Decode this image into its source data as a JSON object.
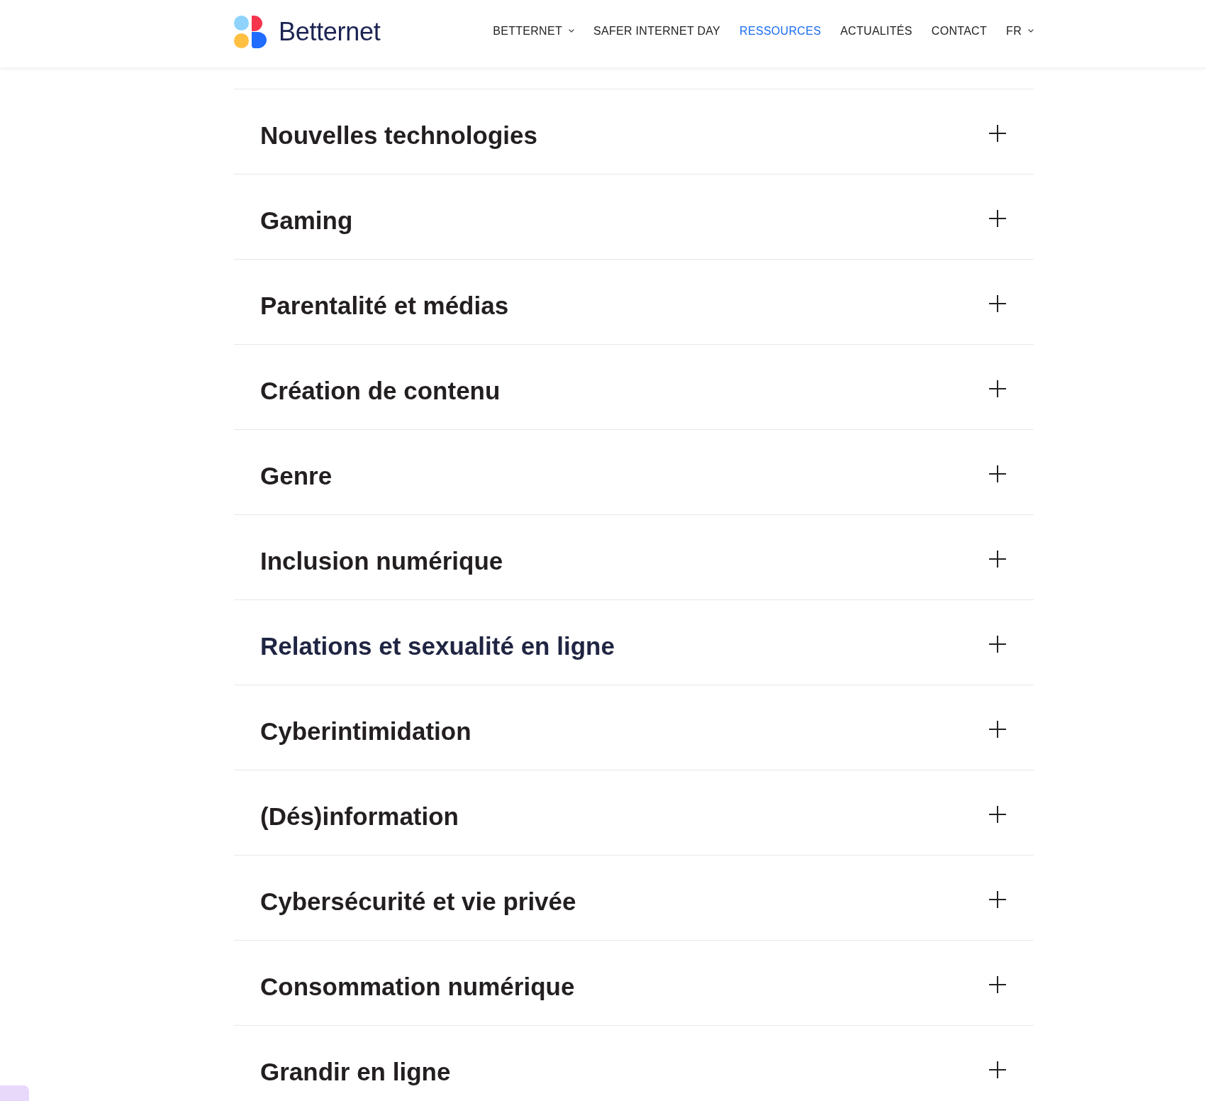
{
  "header": {
    "logo": {
      "text": "Betternet"
    },
    "nav": [
      {
        "label": "BETTERNET",
        "selected": false,
        "dropdown": true
      },
      {
        "label": "SAFER INTERNET DAY",
        "selected": false,
        "dropdown": false
      },
      {
        "label": "RESSOURCES",
        "selected": true,
        "dropdown": false
      },
      {
        "label": "ACTUALITÉS",
        "selected": false,
        "dropdown": false
      },
      {
        "label": "CONTACT",
        "selected": false,
        "dropdown": false
      },
      {
        "label": "FR",
        "selected": false,
        "dropdown": true
      }
    ]
  },
  "accordion": {
    "items": [
      {
        "title": "Nouvelles technologies",
        "expanded": false,
        "hovered": false
      },
      {
        "title": "Gaming",
        "expanded": false,
        "hovered": false
      },
      {
        "title": "Parentalité et médias",
        "expanded": false,
        "hovered": false
      },
      {
        "title": "Création de contenu",
        "expanded": false,
        "hovered": false
      },
      {
        "title": "Genre",
        "expanded": false,
        "hovered": false
      },
      {
        "title": "Inclusion numérique",
        "expanded": false,
        "hovered": false
      },
      {
        "title": "Relations et sexualité en ligne",
        "expanded": false,
        "hovered": true
      },
      {
        "title": "Cyberintimidation",
        "expanded": false,
        "hovered": false
      },
      {
        "title": "(Dés)information",
        "expanded": false,
        "hovered": false
      },
      {
        "title": "Cybersécurité et vie privée",
        "expanded": false,
        "hovered": false
      },
      {
        "title": "Consommation numérique",
        "expanded": false,
        "hovered": false
      },
      {
        "title": "Grandir en ligne",
        "expanded": false,
        "hovered": false
      }
    ]
  }
}
